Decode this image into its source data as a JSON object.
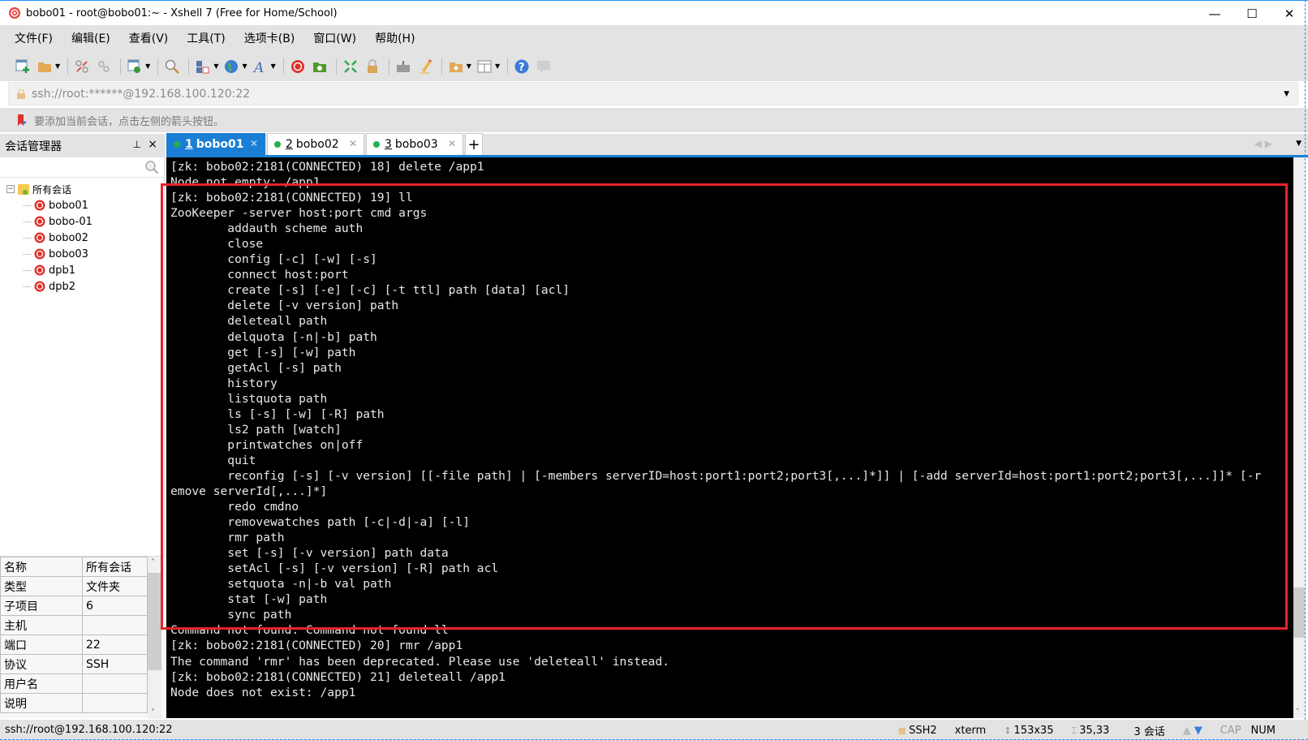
{
  "window": {
    "title": "bobo01 - root@bobo01:~ - Xshell 7 (Free for Home/School)",
    "controls": {
      "minimize": "—",
      "maximize": "☐",
      "close": "✕"
    }
  },
  "menu": [
    "文件(F)",
    "编辑(E)",
    "查看(V)",
    "工具(T)",
    "选项卡(B)",
    "窗口(W)",
    "帮助(H)"
  ],
  "toolbar": {
    "icons": [
      "new-session-icon",
      "open-folder-icon",
      "reconnect-icon",
      "disconnect-icon",
      "properties-icon",
      "find-icon",
      "transfer-icon",
      "globe-icon",
      "font-icon",
      "xshell-icon",
      "xftp-icon",
      "fullscreen-icon",
      "lock-icon",
      "keyboard-icon",
      "highlight-icon",
      "new-tab-group-icon",
      "layout-icon",
      "help-icon",
      "chat-icon"
    ]
  },
  "address": {
    "value": "ssh://root:******@192.168.100.120:22"
  },
  "hint": {
    "text": "要添加当前会话，点击左侧的箭头按钮。"
  },
  "session_manager": {
    "title": "会话管理器",
    "pin": "📌",
    "close": "×",
    "search_placeholder": "",
    "root_label": "所有会话",
    "sessions": [
      "bobo01",
      "bobo-01",
      "bobo02",
      "bobo03",
      "dpb1",
      "dpb2"
    ],
    "properties": [
      {
        "key": "名称",
        "value": "所有会话"
      },
      {
        "key": "类型",
        "value": "文件夹"
      },
      {
        "key": "子项目",
        "value": "6"
      },
      {
        "key": "主机",
        "value": ""
      },
      {
        "key": "端口",
        "value": "22"
      },
      {
        "key": "协议",
        "value": "SSH"
      },
      {
        "key": "用户名",
        "value": ""
      },
      {
        "key": "说明",
        "value": ""
      }
    ]
  },
  "tabs": [
    {
      "num": "1",
      "label": "bobo01",
      "active": true,
      "status_color": "#22b14c"
    },
    {
      "num": "2",
      "label": "bobo02",
      "active": false,
      "status_color": "#22b14c"
    },
    {
      "num": "3",
      "label": "bobo03",
      "active": false,
      "status_color": "#22b14c"
    }
  ],
  "tab_add": "+",
  "terminal": {
    "lines": [
      "[zk: bobo02:2181(CONNECTED) 18] delete /app1",
      "Node not empty: /app1",
      "[zk: bobo02:2181(CONNECTED) 19] ll",
      "ZooKeeper -server host:port cmd args",
      "        addauth scheme auth",
      "        close",
      "        config [-c] [-w] [-s]",
      "        connect host:port",
      "        create [-s] [-e] [-c] [-t ttl] path [data] [acl]",
      "        delete [-v version] path",
      "        deleteall path",
      "        delquota [-n|-b] path",
      "        get [-s] [-w] path",
      "        getAcl [-s] path",
      "        history",
      "        listquota path",
      "        ls [-s] [-w] [-R] path",
      "        ls2 path [watch]",
      "        printwatches on|off",
      "        quit",
      "        reconfig [-s] [-v version] [[-file path] | [-members serverID=host:port1:port2;port3[,...]*]] | [-add serverId=host:port1:port2;port3[,...]]* [-r",
      "emove serverId[,...]*]",
      "        redo cmdno",
      "        removewatches path [-c|-d|-a] [-l]",
      "        rmr path",
      "        set [-s] [-v version] path data",
      "        setAcl [-s] [-v version] [-R] path acl",
      "        setquota -n|-b val path",
      "        stat [-w] path",
      "        sync path",
      "Command not found: Command not found ll",
      "[zk: bobo02:2181(CONNECTED) 20] rmr /app1",
      "The command 'rmr' has been deprecated. Please use 'deleteall' instead.",
      "[zk: bobo02:2181(CONNECTED) 21] deleteall /app1",
      "Node does not exist: /app1"
    ],
    "highlight_color": "#e8232c"
  },
  "status": {
    "connection": "ssh://root@192.168.100.120:22",
    "protocol": "SSH2",
    "terminal_type": "xterm",
    "size": "153x35",
    "cursor": "35,33",
    "sessions": "3 会话",
    "cap": "CAP",
    "num": "NUM"
  }
}
